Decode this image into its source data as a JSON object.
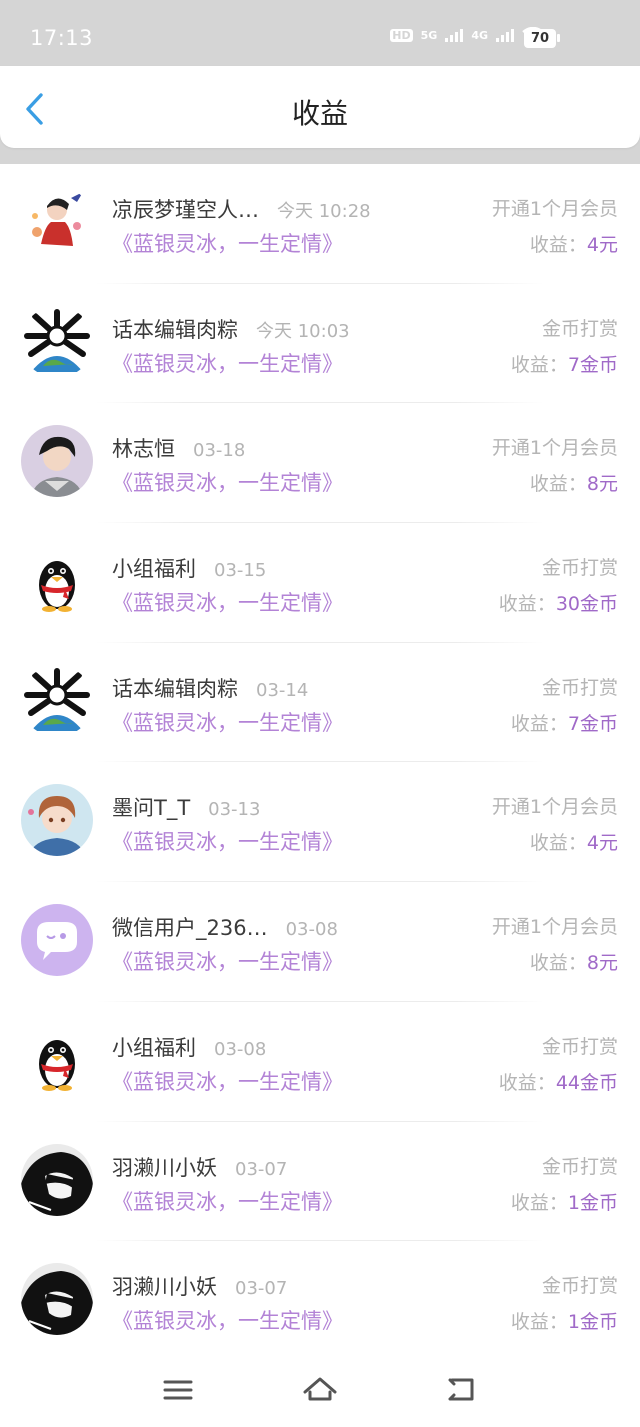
{
  "status_bar": {
    "time": "17:13",
    "battery": "70",
    "net1": "5G",
    "net2": "4G",
    "hd": "HD"
  },
  "header": {
    "title": "收益"
  },
  "income_prefix": "收益：",
  "records": [
    {
      "name": "凉辰梦瑾空人…",
      "time": "今天 10:28",
      "book": "《蓝银灵冰，一生定情》",
      "type": "开通1个月会员",
      "amount": "4元",
      "avatar": "anime-red"
    },
    {
      "name": "话本编辑肉粽",
      "time": "今天 10:03",
      "book": "《蓝银灵冰，一生定情》",
      "type": "金币打赏",
      "amount": "7金币",
      "avatar": "globe-bones"
    },
    {
      "name": "林志恒",
      "time": "03-18",
      "book": "《蓝银灵冰，一生定情》",
      "type": "开通1个月会员",
      "amount": "8元",
      "avatar": "anime-boy"
    },
    {
      "name": "小组福利",
      "time": "03-15",
      "book": "《蓝银灵冰，一生定情》",
      "type": "金币打赏",
      "amount": "30金币",
      "avatar": "penguin"
    },
    {
      "name": "话本编辑肉粽",
      "time": "03-14",
      "book": "《蓝银灵冰，一生定情》",
      "type": "金币打赏",
      "amount": "7金币",
      "avatar": "globe-bones"
    },
    {
      "name": "墨问T_T",
      "time": "03-13",
      "book": "《蓝银灵冰，一生定情》",
      "type": "开通1个月会员",
      "amount": "4元",
      "avatar": "anime-girl"
    },
    {
      "name": "微信用户_236…",
      "time": "03-08",
      "book": "《蓝银灵冰，一生定情》",
      "type": "开通1个月会员",
      "amount": "8元",
      "avatar": "chat-bubble"
    },
    {
      "name": "小组福利",
      "time": "03-08",
      "book": "《蓝银灵冰，一生定情》",
      "type": "金币打赏",
      "amount": "44金币",
      "avatar": "penguin"
    },
    {
      "name": "羽濑川小妖",
      "time": "03-07",
      "book": "《蓝银灵冰，一生定情》",
      "type": "金币打赏",
      "amount": "1金币",
      "avatar": "dark-portrait"
    },
    {
      "name": "羽濑川小妖",
      "time": "03-07",
      "book": "《蓝银灵冰，一生定情》",
      "type": "金币打赏",
      "amount": "1金币",
      "avatar": "dark-portrait"
    }
  ],
  "colors": {
    "accent_purple": "#a06ac8",
    "back_blue": "#3a9ee4"
  }
}
